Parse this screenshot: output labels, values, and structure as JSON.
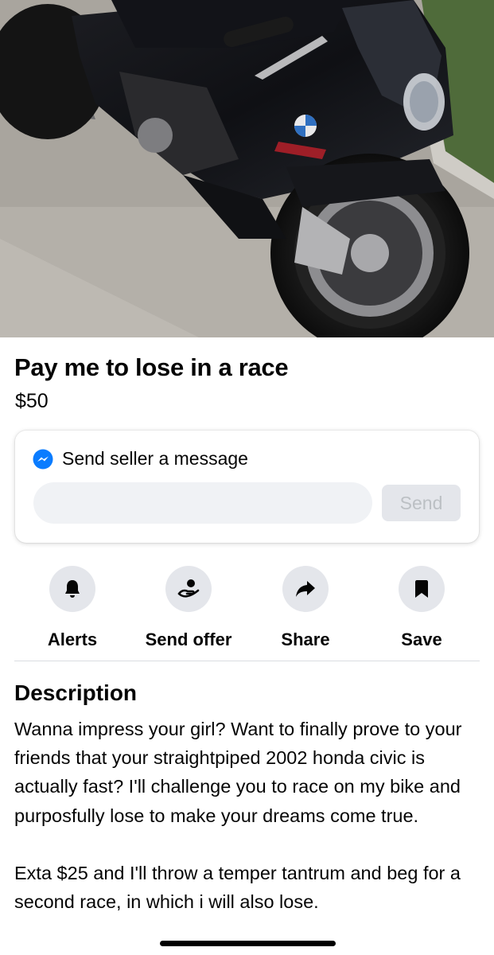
{
  "listing": {
    "title": "Pay me to lose in a race",
    "price": "$50",
    "photo_alt": "photo"
  },
  "message_box": {
    "heading": "Send seller a message",
    "input_value": "",
    "send_label": "Send",
    "icon": "messenger-icon",
    "accent_color": "#0a7cff"
  },
  "actions": [
    {
      "label": "Alerts",
      "icon": "bell-icon"
    },
    {
      "label": "Send offer",
      "icon": "offer-hand-icon"
    },
    {
      "label": "Share",
      "icon": "share-arrow-icon"
    },
    {
      "label": "Save",
      "icon": "bookmark-icon"
    }
  ],
  "description": {
    "heading": "Description",
    "body": "Wanna impress your girl? Want to finally prove to your friends that your straightpiped 2002 honda civic is actually fast? I'll challenge you to race on my bike and purposfully lose to make your dreams come true.\n\nExta $25 and I'll throw a temper tantrum and beg for a second race, in which i will also lose."
  }
}
